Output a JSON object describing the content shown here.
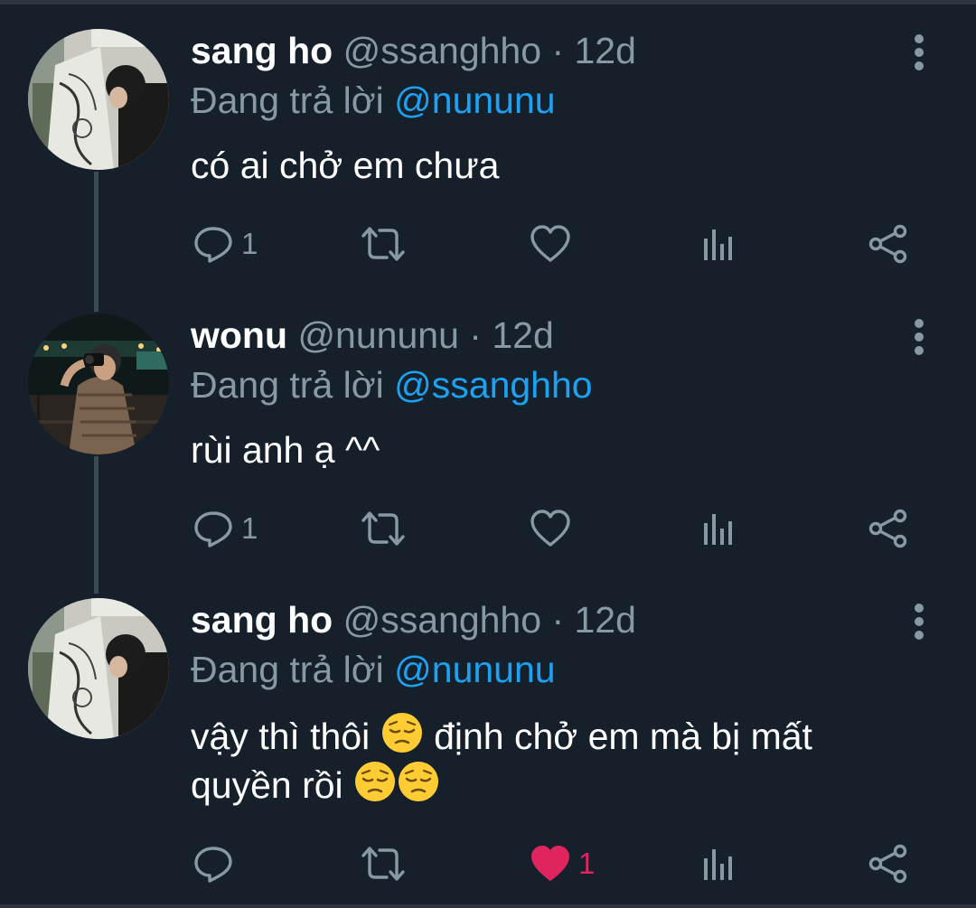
{
  "tweets": [
    {
      "name": "sang ho",
      "handle": "@ssanghho",
      "separator": "·",
      "time": "12d",
      "reply_prefix": "Đang trả lời",
      "reply_to": "@nununu",
      "text_line1": "có ai chở em chưa",
      "reply_count": "1",
      "like_count": "",
      "liked": false
    },
    {
      "name": "wonu",
      "handle": "@nununu",
      "separator": "·",
      "time": "12d",
      "reply_prefix": "Đang trả lời",
      "reply_to": "@ssanghho",
      "text_line1": "rùi anh ạ ^^",
      "reply_count": "1",
      "like_count": "",
      "liked": false
    },
    {
      "name": "sang ho",
      "handle": "@ssanghho",
      "separator": "·",
      "time": "12d",
      "reply_prefix": "Đang trả lời",
      "reply_to": "@nununu",
      "text_part1": "vậy thì thôi",
      "text_part2": "định chở em mà bị mất",
      "text_part3": "quyền rồi",
      "reply_count": "",
      "like_count": "1",
      "liked": true
    }
  ],
  "icons": {
    "reply": "reply-icon",
    "retweet": "retweet-icon",
    "like": "heart-icon",
    "analytics": "analytics-icon",
    "share": "share-icon",
    "more": "more-vertical-icon",
    "emoji": "pensive-face-emoji"
  },
  "colors": {
    "background": "#15202b",
    "secondary_text": "#8899a6",
    "mention": "#1da1f2",
    "like_active": "#e0245e"
  }
}
